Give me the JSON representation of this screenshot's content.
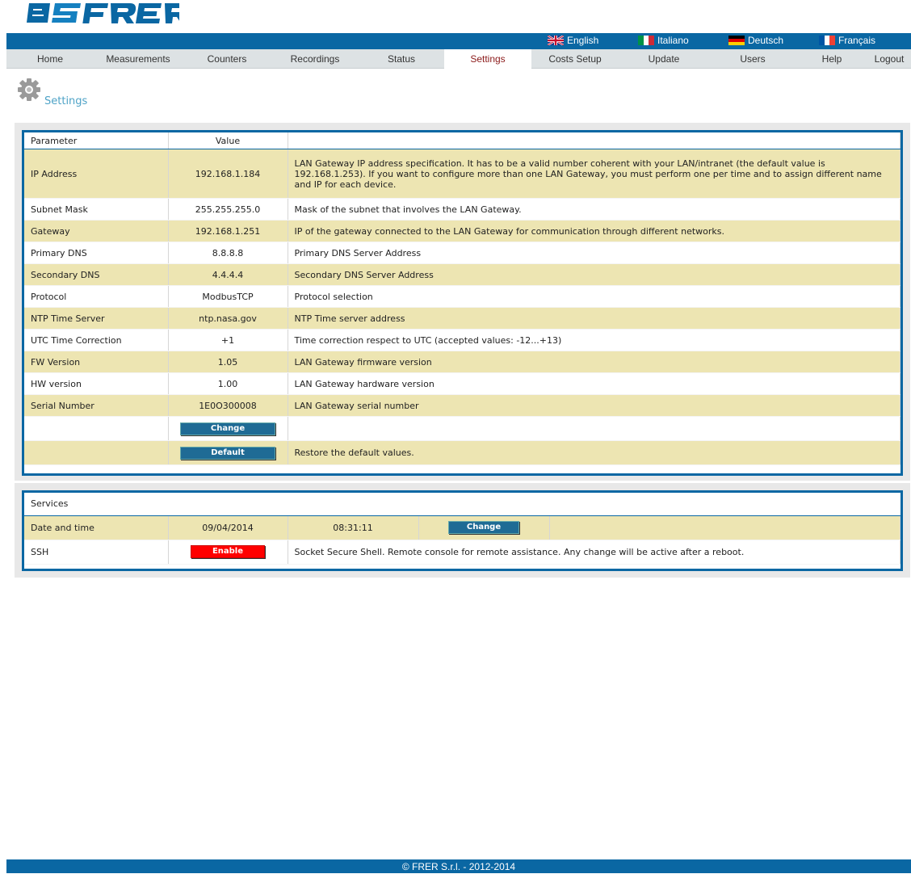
{
  "brand": {
    "logo_text": "FRER"
  },
  "languages": [
    {
      "label": "English"
    },
    {
      "label": "Italiano"
    },
    {
      "label": "Deutsch"
    },
    {
      "label": "Français"
    }
  ],
  "nav": [
    {
      "label": "Home"
    },
    {
      "label": "Measurements"
    },
    {
      "label": "Counters"
    },
    {
      "label": "Recordings"
    },
    {
      "label": "Status"
    },
    {
      "label": "Settings"
    },
    {
      "label": "Costs Setup"
    },
    {
      "label": "Update"
    },
    {
      "label": "Users"
    },
    {
      "label": "Help"
    },
    {
      "label": "Logout"
    }
  ],
  "page": {
    "title": "Settings"
  },
  "settings_table": {
    "col_parameter": "Parameter",
    "col_value": "Value",
    "rows": [
      {
        "param": "IP Address",
        "value": "192.168.1.184",
        "desc": "LAN Gateway IP address specification. It has to be a valid number coherent with your LAN/intranet (the default value is 192.168.1.253). If you want to configure more than one LAN Gateway, you must perform one per time and to assign different name and IP for each device."
      },
      {
        "param": "Subnet Mask",
        "value": "255.255.255.0",
        "desc": "Mask of the subnet that involves the LAN Gateway."
      },
      {
        "param": "Gateway",
        "value": "192.168.1.251",
        "desc": "IP of the gateway connected to the LAN Gateway for communication through different networks."
      },
      {
        "param": "Primary DNS",
        "value": "8.8.8.8",
        "desc": "Primary DNS Server Address"
      },
      {
        "param": "Secondary DNS",
        "value": "4.4.4.4",
        "desc": "Secondary DNS Server Address"
      },
      {
        "param": "Protocol",
        "value": "ModbusTCP",
        "desc": "Protocol selection"
      },
      {
        "param": "NTP Time Server",
        "value": "ntp.nasa.gov",
        "desc": "NTP Time server address"
      },
      {
        "param": "UTC Time Correction",
        "value": "+1",
        "desc": "Time correction respect to UTC (accepted values: -12...+13)"
      },
      {
        "param": "FW Version",
        "value": "1.05",
        "desc": "LAN Gateway firmware version"
      },
      {
        "param": "HW version",
        "value": "1.00",
        "desc": "LAN Gateway hardware version"
      },
      {
        "param": "Serial Number",
        "value": "1E0O300008",
        "desc": "LAN Gateway serial number"
      }
    ],
    "change_label": "Change",
    "default_label": "Default",
    "default_desc": "Restore the default values."
  },
  "services": {
    "header": "Services",
    "date_label": "Date and time",
    "date_value": "09/04/2014",
    "time_value": "08:31:11",
    "change_label": "Change",
    "ssh_label": "SSH",
    "ssh_button": "Enable",
    "ssh_desc": "Socket Secure Shell. Remote console for remote assistance. Any change will be active after a reboot."
  },
  "footer": {
    "text": "© FRER S.r.l. - 2012-2014"
  },
  "colors": {
    "brand_blue": "#0a67a3",
    "row_tan": "#ede5b2",
    "active_tab": "#8b1a1a",
    "enable_red": "#ff0000"
  }
}
